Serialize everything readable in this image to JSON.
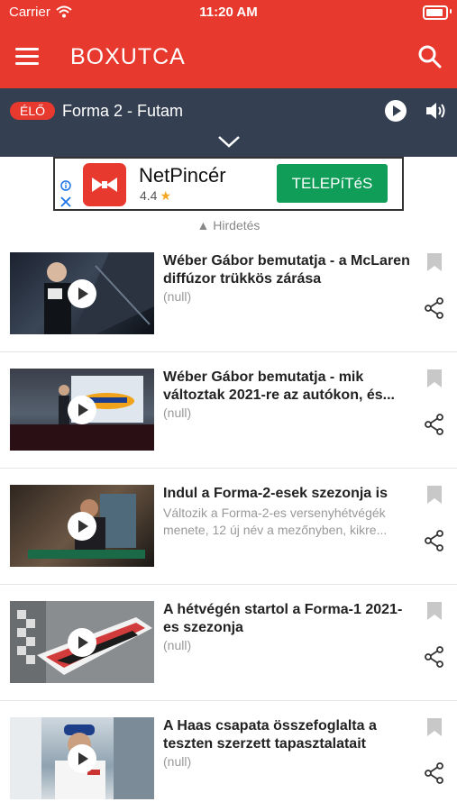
{
  "status_bar": {
    "carrier": "Carrier",
    "time": "11:20 AM"
  },
  "header": {
    "logo_text": "BOXUTCA",
    "menu_icon": "hamburger-icon",
    "search_icon": "search-icon"
  },
  "live_bar": {
    "badge": "ÉLŐ",
    "title": "Forma 2 - Futam"
  },
  "ad": {
    "app_name": "NetPincér",
    "rating": "4.4",
    "install_label": "TELEPíTéS",
    "ad_label": "▲ Hirdetés"
  },
  "feed": {
    "items": [
      {
        "title": "Wéber Gábor bemutatja - a McLaren diffúzor trükkös zárása",
        "subtitle": "(null)"
      },
      {
        "title": "Wéber Gábor bemutatja - mik változtak 2021-re az autókon, és...",
        "subtitle": "(null)"
      },
      {
        "title": "Indul a Forma-2-esek szezonja is",
        "subtitle": "Változik a Forma-2-es versenyhétvégék menete, 12 új név a mezőnyben, kikre..."
      },
      {
        "title": "A hétvégén startol a Forma-1 2021-es szezonja",
        "subtitle": "(null)"
      },
      {
        "title": "A Haas csapata összefoglalta a teszten szerzett tapasztalatait",
        "subtitle": "(null)"
      }
    ]
  },
  "colors": {
    "brand_red": "#e8392f",
    "live_bar": "#343f52",
    "install_green": "#0f9d58"
  }
}
